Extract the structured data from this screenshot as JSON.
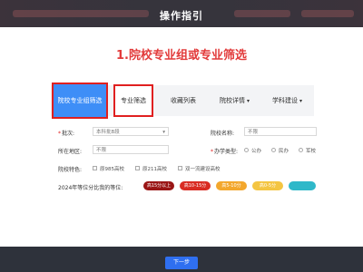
{
  "modal": {
    "title": "操作指引"
  },
  "step": {
    "heading": "1.院校专业组或专业筛选"
  },
  "tabs": [
    {
      "label": "院校专业组筛选",
      "dropdown": false
    },
    {
      "label": "专业筛选",
      "dropdown": false
    },
    {
      "label": "收藏列表",
      "dropdown": false
    },
    {
      "label": "院校详情",
      "dropdown": true
    },
    {
      "label": "学科建设",
      "dropdown": true
    }
  ],
  "form": {
    "batch_label": "批次:",
    "batch_value": "本科批B段",
    "school_name_label": "院校名称:",
    "school_name_placeholder": "不限",
    "region_label": "所在地区:",
    "region_placeholder": "不限",
    "type_label": "办学类型:",
    "type_options": [
      "公办",
      "民办",
      "军校"
    ],
    "feature_label": "院校特色:",
    "feature_options": [
      "原985高校",
      "原211高校",
      "双一流建设高校"
    ],
    "rank_label": "2024年等位分比我的等位:",
    "rank_pills": [
      {
        "label": "高15分以上",
        "color": "#9a1515"
      },
      {
        "label": "高10-15分",
        "color": "#d92b22"
      },
      {
        "label": "高5-10分",
        "color": "#f3a72d"
      },
      {
        "label": "高0-5分",
        "color": "#f4c542"
      },
      {
        "label": "",
        "color": "#2fb8c9"
      }
    ]
  },
  "footer": {
    "next_label": "下一步"
  },
  "colors": {
    "accent": "#3e8ef7",
    "highlight": "#e02020",
    "heading": "#e23b3b",
    "bar": "#2e323b"
  }
}
